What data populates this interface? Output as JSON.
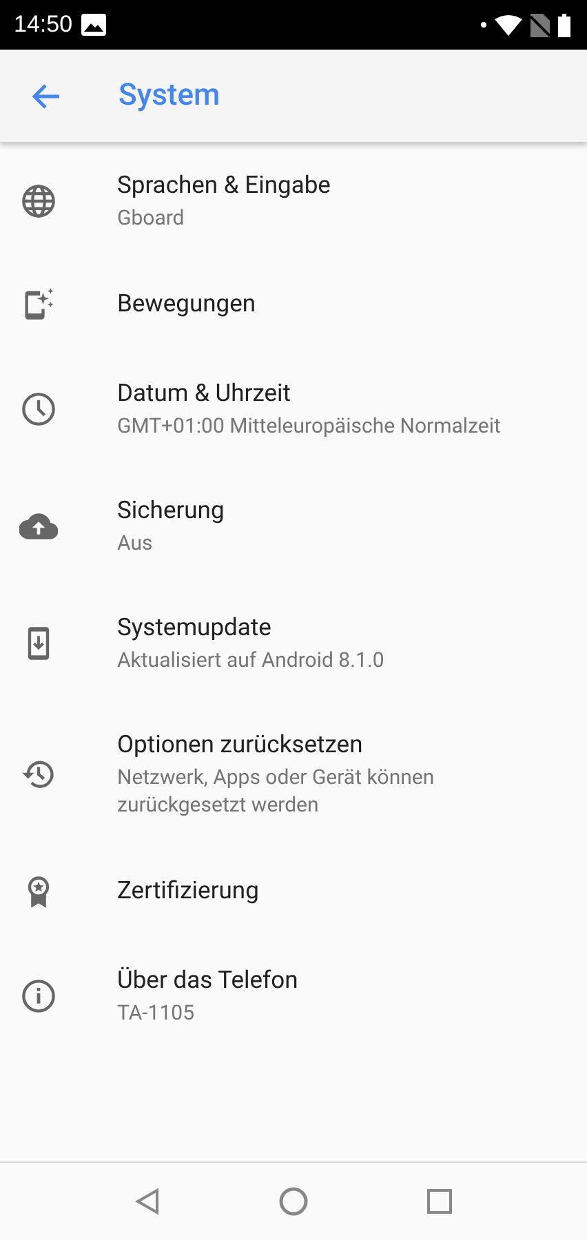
{
  "status_bar": {
    "time": "14:50"
  },
  "app_bar": {
    "title": "System"
  },
  "items": [
    {
      "title": "Sprachen & Eingabe",
      "subtitle": "Gboard"
    },
    {
      "title": "Bewegungen"
    },
    {
      "title": "Datum & Uhrzeit",
      "subtitle": "GMT+01:00 Mitteleuropäische Normalzeit"
    },
    {
      "title": "Sicherung",
      "subtitle": "Aus"
    },
    {
      "title": "Systemupdate",
      "subtitle": "Aktualisiert auf Android 8.1.0"
    },
    {
      "title": "Optionen zurücksetzen",
      "subtitle": "Netzwerk, Apps oder Gerät können zurückgesetzt werden"
    },
    {
      "title": "Zertifizierung"
    },
    {
      "title": "Über das Telefon",
      "subtitle": "TA-1105"
    }
  ]
}
